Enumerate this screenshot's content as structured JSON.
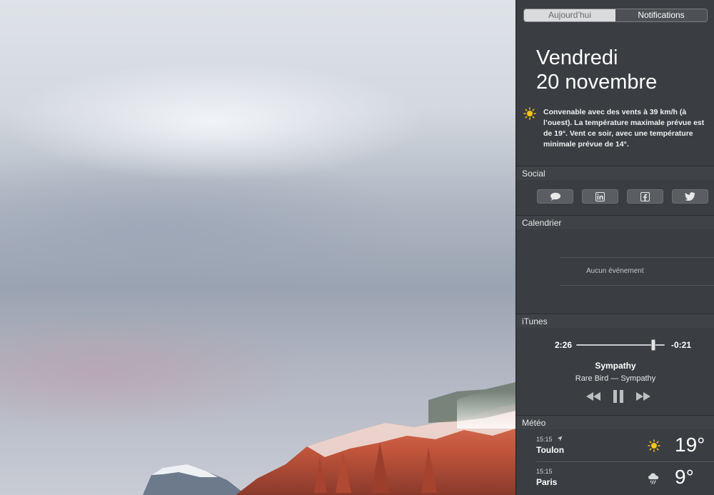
{
  "segmented_control": {
    "today_label": "Aujourd’hui",
    "notifications_label": "Notifications"
  },
  "today": {
    "weekday": "Vendredi",
    "date": "20 novembre",
    "weather_summary": "Convenable avec des vents à 39 km/h (à l’ouest). La température maximale prévue est de 19°. Vent ce soir, avec une température minimale prévue de 14°.",
    "summary_icon": "sun-icon"
  },
  "social": {
    "title": "Social",
    "buttons": [
      {
        "icon": "message-icon"
      },
      {
        "icon": "linkedin-icon"
      },
      {
        "icon": "facebook-icon"
      },
      {
        "icon": "twitter-icon"
      }
    ]
  },
  "calendar": {
    "title": "Calendrier",
    "empty_text": "Aucun événement"
  },
  "itunes": {
    "title": "iTunes",
    "elapsed": "2:26",
    "remaining": "-0:21",
    "progress_fraction": 0.87,
    "song": "Sympathy",
    "artist_album": "Rare Bird — Sympathy",
    "controls": [
      "rewind-icon",
      "pause-icon",
      "fast-forward-icon"
    ]
  },
  "weather": {
    "title": "Météo",
    "locations": [
      {
        "time": "15:15",
        "city": "Toulon",
        "temp": "19°",
        "icon": "sun-icon",
        "current_location": true
      },
      {
        "time": "15:15",
        "city": "Paris",
        "temp": "9°",
        "icon": "rain-cloud-icon",
        "current_location": false
      }
    ]
  },
  "colors": {
    "panel_bg": "#34373c",
    "section_header_bg": "#3f4247",
    "sun": "#f5c518",
    "segment_selected": "#dadbdc"
  }
}
